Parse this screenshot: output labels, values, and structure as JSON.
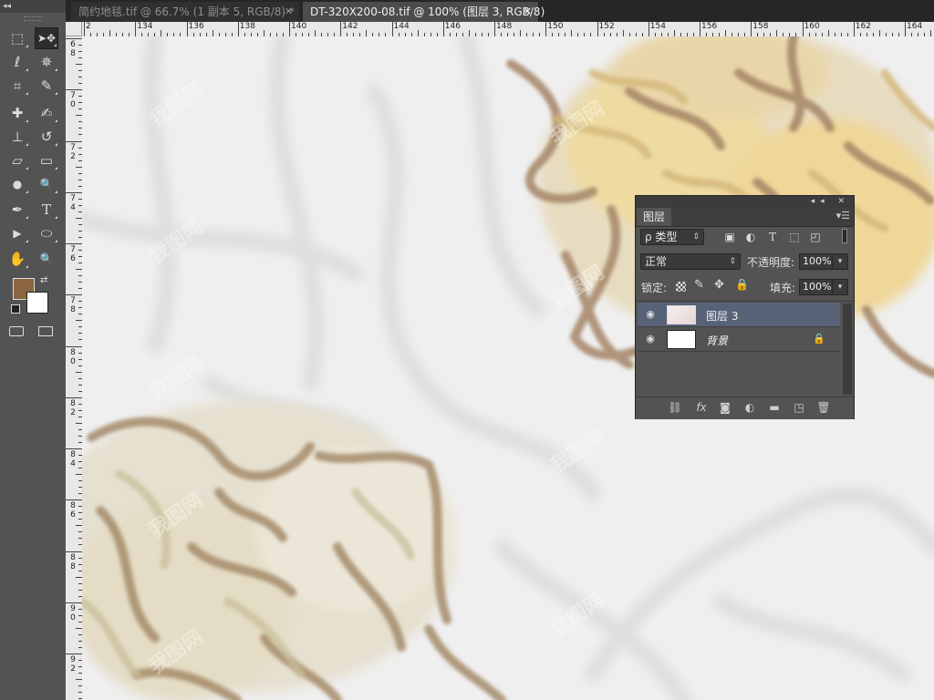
{
  "app": {
    "name": "Photoshop"
  },
  "tabs": [
    {
      "label": "简约地毯.tif @ 66.7% (1 副本 5, RGB/8) *",
      "close": "✕",
      "active": false
    },
    {
      "label": "DT-320X200-08.tif @ 100% (图层 3, RGB/8)",
      "close": "✕",
      "active": true
    }
  ],
  "ruler": {
    "h_labels": [
      "2",
      "134",
      "136",
      "138",
      "140",
      "142",
      "144",
      "146",
      "148",
      "150",
      "152",
      "154",
      "156",
      "158",
      "160",
      "162",
      "164"
    ],
    "v_labels": [
      [
        "6",
        "8"
      ],
      [
        "7",
        "0"
      ],
      [
        "7",
        "2"
      ],
      [
        "7",
        "4"
      ],
      [
        "7",
        "6"
      ],
      [
        "7",
        "8"
      ],
      [
        "8",
        "0"
      ],
      [
        "8",
        "2"
      ],
      [
        "8",
        "4"
      ],
      [
        "8",
        "6"
      ],
      [
        "8",
        "8"
      ],
      [
        "9",
        "0"
      ],
      [
        "9",
        "2"
      ]
    ]
  },
  "toolbar": {
    "collapse": "◂◂",
    "tools": [
      {
        "name": "rectangular-marquee-tool",
        "glyph": "⬚"
      },
      {
        "name": "move-tool",
        "glyph": "➤✥"
      },
      {
        "name": "lasso-tool",
        "glyph": "ℓ"
      },
      {
        "name": "magic-wand-tool",
        "glyph": "✵"
      },
      {
        "name": "crop-tool",
        "glyph": "⌗"
      },
      {
        "name": "eyedropper-tool",
        "glyph": "✎"
      },
      {
        "name": "healing-brush-tool",
        "glyph": "✚"
      },
      {
        "name": "brush-tool",
        "glyph": "✍"
      },
      {
        "name": "clone-stamp-tool",
        "glyph": "⊥"
      },
      {
        "name": "history-brush-tool",
        "glyph": "↺"
      },
      {
        "name": "eraser-tool",
        "glyph": "▱"
      },
      {
        "name": "gradient-tool",
        "glyph": "▭"
      },
      {
        "name": "blur-tool",
        "glyph": "●"
      },
      {
        "name": "dodge-tool",
        "glyph": "🔍"
      },
      {
        "name": "pen-tool",
        "glyph": "✒"
      },
      {
        "name": "type-tool",
        "glyph": "T"
      },
      {
        "name": "path-selection-tool",
        "glyph": "▶"
      },
      {
        "name": "ellipse-tool",
        "glyph": "⬭"
      },
      {
        "name": "hand-tool",
        "glyph": "✋"
      },
      {
        "name": "zoom-tool",
        "glyph": "🔍"
      }
    ],
    "foreground_color": "#8b6540",
    "background_color": "#ffffff"
  },
  "layers_panel": {
    "panel_controls": "◂◂ ✕",
    "tab_label": "图层",
    "menu_icon": "▾☰",
    "filter": {
      "label": "ρ 类型",
      "arrow": "⇕"
    },
    "blend_mode": "正常",
    "opacity_label": "不透明度:",
    "opacity_value": "100%",
    "lock_label": "锁定:",
    "fill_label": "填充:",
    "fill_value": "100%",
    "layers": [
      {
        "name": "图层 3",
        "selected": true
      },
      {
        "name": "背景",
        "selected": false,
        "locked": true
      }
    ]
  },
  "colors": {
    "accent_selected_layer": "#586276",
    "panel_bg": "#535353",
    "canvas_bg": "#efefef"
  }
}
